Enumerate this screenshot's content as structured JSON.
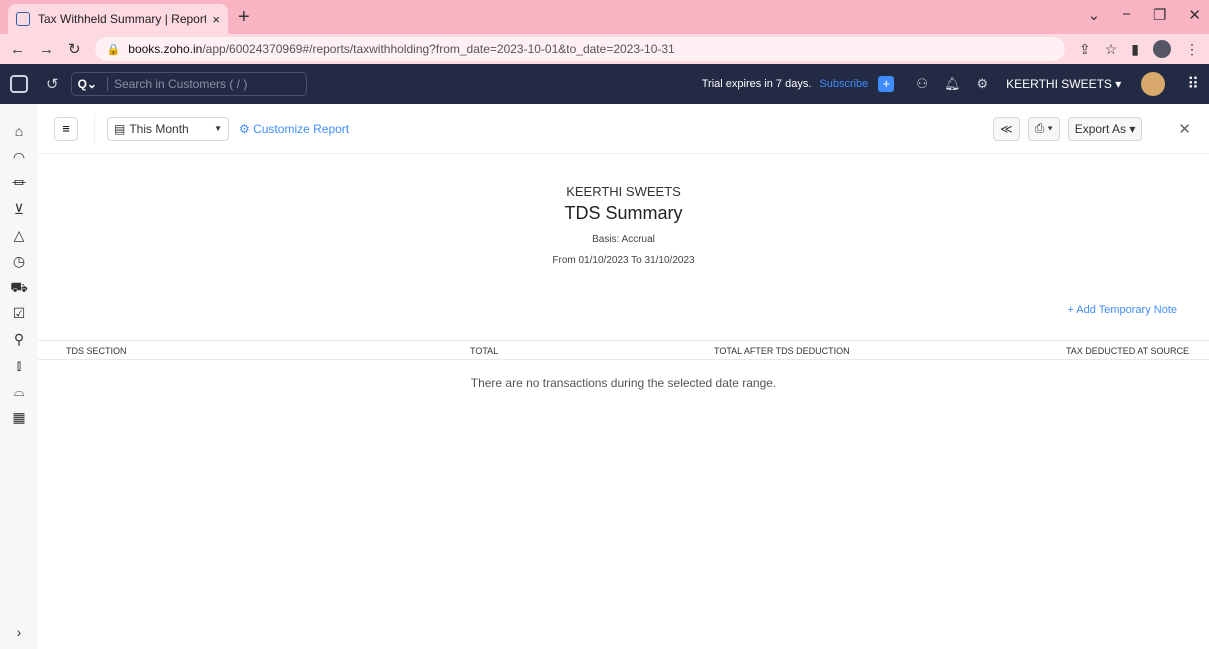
{
  "browser": {
    "tab_title": "Tax Withheld Summary | Reports",
    "tab_close": "×",
    "new_tab": "+",
    "url_host": "books.zoho.in",
    "url_path": "/app/60024370969#/reports/taxwithholding?from_date=2023-10-01&to_date=2023-10-31"
  },
  "header": {
    "search_placeholder": "Search in Customers ( / )",
    "trial_text": "Trial expires in 7 days.",
    "subscribe_label": "Subscribe",
    "org_name": "KEERTHI SWEETS ▾"
  },
  "toolbar": {
    "period_label": "This Month",
    "customize_label": "Customize Report",
    "export_label": "Export As"
  },
  "report": {
    "org": "KEERTHI SWEETS",
    "title": "TDS Summary",
    "basis": "Basis: Accrual",
    "range": "From 01/10/2023 To 31/10/2023",
    "add_note": "+ Add Temporary Note",
    "columns": [
      "TDS SECTION",
      "TOTAL",
      "TOTAL AFTER TDS DEDUCTION",
      "TAX DEDUCTED AT SOURCE"
    ],
    "empty_message": "There are no transactions during the selected date range."
  }
}
